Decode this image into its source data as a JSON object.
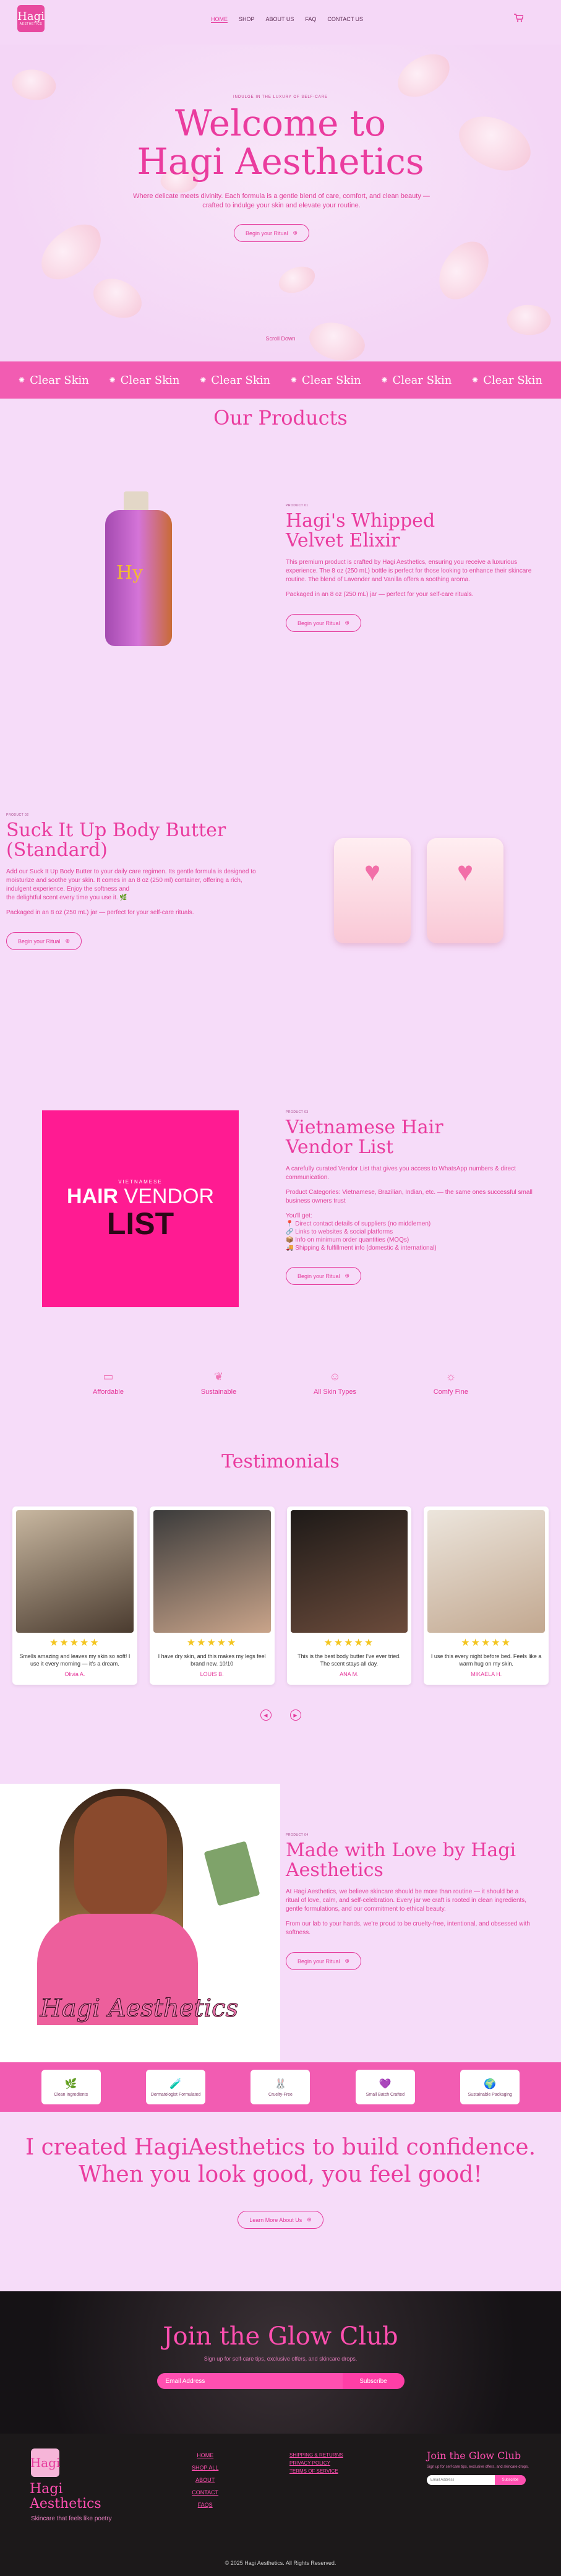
{
  "nav": {
    "logo_monogram": "Hagi",
    "logo_sub": "AESTHETICS",
    "items": [
      "HOME",
      "SHOP",
      "ABOUT US",
      "FAQ",
      "CONTACT US"
    ],
    "cart_icon": "cart-icon"
  },
  "hero": {
    "kicker": "INDULGE IN THE LUXURY OF SELF-CARE",
    "title_line1": "Welcome to",
    "title_line2": "Hagi Aesthetics",
    "subtitle": "Where delicate meets divinity. Each formula is a gentle blend of care, comfort, and clean beauty — crafted to indulge your skin and elevate your routine.",
    "cta": "Begin your Ritual",
    "scroll": "Scroll Down"
  },
  "marquee": {
    "items": [
      "Clear Skin",
      "Clear Skin",
      "Clear Skin",
      "Clear Skin",
      "Clear Skin",
      "Clear Skin"
    ]
  },
  "products": {
    "title": "Our Products",
    "items": [
      {
        "kicker": "PRODUCT 01",
        "name_line1": "Hagi's Whipped",
        "name_line2": "Velvet Elixir",
        "desc1": " This premium product is crafted by Hagi Aesthetics, ensuring you receive a luxurious experience. The 8 oz (250 mL) bottle is perfect for those looking to enhance their skincare routine. The blend of Lavender and Vanilla offers a soothing aroma.",
        "desc2": "Packaged in an 8 oz (250 mL) jar — perfect for your self-care rituals.",
        "cta": "Begin your Ritual"
      },
      {
        "kicker": "PRODUCT 02",
        "name_line1": "Suck It Up Body Butter",
        "name_line2": "(Standard)",
        "desc1": "Add our Suck It Up Body Butter to your daily care regimen. Its gentle formula is designed to moisturize and soothe your skin. It comes in an 8 oz (250 ml) container, offering a rich, indulgent experience. Enjoy the softness and",
        "desc1b": "the delightful scent every time you use it. 🌿",
        "desc2": "Packaged in an 8 oz (250 mL) jar — perfect for your self-care rituals.",
        "cta": "Begin your Ritual"
      },
      {
        "kicker": "PRODUCT 03",
        "name_line1": "Vietnamese Hair",
        "name_line2": "Vendor List",
        "desc1": "A carefully curated Vendor List that gives you access to WhatsApp numbers & direct communication.",
        "desc2": "Product Categories: Vietnamese, Brazilian, Indian, etc. — the same ones successful small business owners trust",
        "bullets": [
          "You'll get:",
          "📍 Direct contact details of suppliers (no middlemen)",
          "🔗 Links to websites & social platforms",
          "📦 Info on minimum order quantities (MOQs)",
          "🚚 Shipping & fulfillment info (domestic & international)"
        ],
        "box_kicker": "VIETNAMESE",
        "box_title1": "HAIR",
        "box_title2": "VENDOR",
        "box_title3": "LIST",
        "cta": "Begin your Ritual"
      }
    ]
  },
  "features": [
    {
      "icon": "wallet-icon",
      "label": "Affordable"
    },
    {
      "icon": "leaf-icon",
      "label": "Sustainable"
    },
    {
      "icon": "user-plus-icon",
      "label": "All Skin Types"
    },
    {
      "icon": "sun-icon",
      "label": "Comfy Fine"
    }
  ],
  "testimonials": {
    "title": "Testimonials",
    "cards": [
      {
        "stars": "★★★★★",
        "quote": "Smells amazing and leaves my skin so soft! I use it every morning — it's a dream.",
        "who": "Olivia A."
      },
      {
        "stars": "★★★★★",
        "quote": "I have dry skin, and this makes my legs feel brand new. 10/10",
        "who": "LOUIS B."
      },
      {
        "stars": "★★★★★",
        "quote": "This is the best body butter I've ever tried. The scent stays all day.",
        "who": "ANA M."
      },
      {
        "stars": "★★★★★",
        "quote": "I use this every night before bed. Feels like a warm hug on my skin.",
        "who": "MIKAELA H."
      }
    ]
  },
  "about": {
    "kicker": "PRODUCT 04",
    "title_line1": "Made with Love by Hagi",
    "title_line2": "Aesthetics",
    "p1": "At Hagi Aesthetics, we believe skincare should be more than routine — it should be a ritual of love, calm, and self-celebration. Every jar we craft is rooted in clean ingredients, gentle formulations, and our commitment to ethical beauty.",
    "p2": "From our lab to your hands, we're proud to be cruelty-free, intentional, and obsessed with softness.",
    "cta": "Begin your Ritual",
    "signature": "Hagi Aesthetics"
  },
  "badges": [
    {
      "icon": "🌿",
      "label": "Clean Ingredients"
    },
    {
      "icon": "🧪",
      "label": "Dermatologist Formulated"
    },
    {
      "icon": "🐰",
      "label": "Cruelty-Free"
    },
    {
      "icon": "💜",
      "label": "Small Batch Crafted"
    },
    {
      "icon": "🌍",
      "label": "Sustainable Packaging"
    }
  ],
  "confidence": {
    "line1": "I created HagiAesthetics to build confidence.",
    "line2": "When you look good, you feel good!",
    "cta": "Learn More About Us"
  },
  "join": {
    "title": "Join the Glow Club",
    "subtitle": "Sign up for self-care tips, exclusive offers, and skincare drops.",
    "email_placeholder": "Email Address",
    "button": "Subscribe"
  },
  "footer": {
    "logo_monogram": "Hagi",
    "name_line1": "Hagi",
    "name_line2": "Aesthetics",
    "tagline": "Skincare that feels like poetry",
    "links": [
      "HOME",
      "SHOP ALL",
      "ABOUT",
      "CONTACT",
      "FAQS"
    ],
    "links2": [
      "SHIPPING & RETURNS",
      "PRIVACY POLICY",
      "TERMS OF SERVICE"
    ],
    "join_title": "Join the Glow Club",
    "join_small": "Sign up for self-care tips, exclusive offers, and skincare drops.",
    "email_placeholder": "Email Address",
    "button": "Subscribe",
    "copyright": "© 2025 Hagi Aesthetics. All Rights Reserved."
  }
}
